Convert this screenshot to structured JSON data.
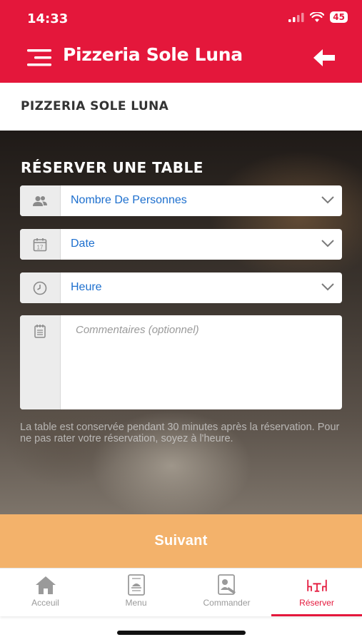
{
  "status_bar": {
    "time": "14:33",
    "battery": "45"
  },
  "header": {
    "title": "Pizzeria Sole Luna"
  },
  "subheader": {
    "title": "PIZZERIA SOLE LUNA"
  },
  "form": {
    "section_title": "RÉSERVER UNE TABLE",
    "fields": [
      {
        "label": "Nombre De Personnes",
        "icon": "people-icon"
      },
      {
        "label": "Date",
        "icon": "calendar-icon"
      },
      {
        "label": "Heure",
        "icon": "clock-icon"
      }
    ],
    "comments": {
      "placeholder": "Commentaires (optionnel)",
      "icon": "notepad-icon"
    },
    "note": "La table est conservée pendant 30 minutes après la réservation. Pour ne pas rater votre réservation, soyez à l'heure."
  },
  "next_button": {
    "label": "Suivant"
  },
  "tabs": [
    {
      "label": "Acceuil",
      "icon": "home-icon",
      "active": false
    },
    {
      "label": "Menu",
      "icon": "menu-book-icon",
      "active": false
    },
    {
      "label": "Commander",
      "icon": "order-icon",
      "active": false
    },
    {
      "label": "Réserver",
      "icon": "table-reserve-icon",
      "active": true
    }
  ],
  "colors": {
    "brand_red": "#e4173b",
    "button_orange": "#f3b26b",
    "link_blue": "#1d6fce"
  }
}
